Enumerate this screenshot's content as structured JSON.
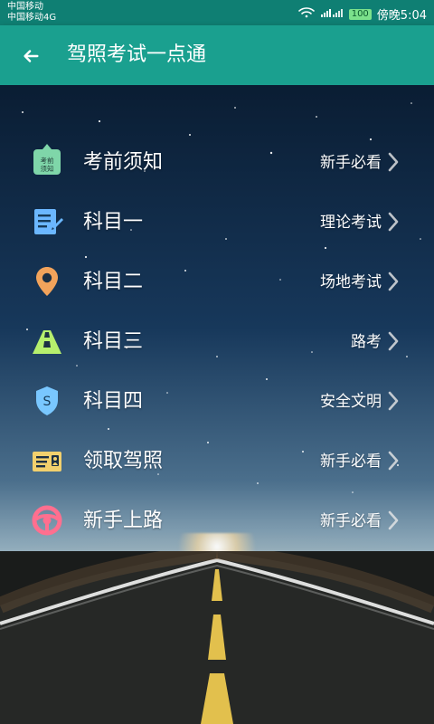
{
  "status": {
    "carrier_line1": "中国移动",
    "carrier_line2": "中国移动4G",
    "battery": "100",
    "time_text": "傍晚5:04"
  },
  "appbar": {
    "title": "驾照考试一点通"
  },
  "menu": [
    {
      "label": "考前须知",
      "hint": "新手必看",
      "icon": "exam-notice-icon",
      "badge_line1": "考前",
      "badge_line2": "须知"
    },
    {
      "label": "科目一",
      "hint": "理论考试",
      "icon": "notepad-edit-icon"
    },
    {
      "label": "科目二",
      "hint": "场地考试",
      "icon": "location-pin-icon"
    },
    {
      "label": "科目三",
      "hint": "路考",
      "icon": "road-icon"
    },
    {
      "label": "科目四",
      "hint": "安全文明",
      "icon": "shield-s-icon",
      "shield_letter": "S"
    },
    {
      "label": "领取驾照",
      "hint": "新手必看",
      "icon": "license-card-icon"
    },
    {
      "label": "新手上路",
      "hint": "新手必看",
      "icon": "steering-wheel-icon"
    }
  ],
  "colors": {
    "statusbar": "#0f7f73",
    "appbar": "#1aa08f",
    "icon_green": "#7fd6a9",
    "icon_blue": "#6bb7ff",
    "icon_orange": "#f2a35b",
    "icon_yellow": "#f2d06d",
    "icon_pink": "#ff6f8f"
  }
}
